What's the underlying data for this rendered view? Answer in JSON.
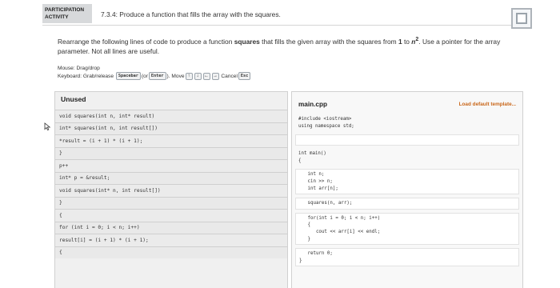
{
  "header": {
    "badge_line1": "PARTICIPATION",
    "badge_line2": "ACTIVITY",
    "title": "7.3.4: Produce a function that fills the array with the squares."
  },
  "instructions": {
    "part1": "Rearrange the following lines of code to produce a function ",
    "bold_name": "squares",
    "part2": " that fills the given array with the squares from ",
    "range_start": "1",
    "part3": " to ",
    "range_end": "n",
    "superscript": "2",
    "part4": ". Use a pointer for the array parameter. Not all lines are useful."
  },
  "controls": {
    "mouse": "Mouse: Drag/drop",
    "keyboard_prefix": "Keyboard: Grab/release",
    "spacebar_key": "Spacebar",
    "or_open": "(or",
    "enter_key": "Enter",
    "or_close": ").",
    "move_label": "Move",
    "arrow_up": "↑",
    "arrow_down": "↓",
    "arrow_left": "←",
    "arrow_right": "→",
    "cancel_label": "Cancel",
    "esc_key": "Esc"
  },
  "unused": {
    "title": "Unused",
    "lines": [
      "void squares(int n, int* result)",
      "int* squares(int n, int result[])",
      "*result = (i + 1) * (i + 1);",
      "}",
      "p++",
      "int* p = &result;",
      "void squares(int* n, int result[])",
      "}",
      "{",
      "for (int i = 0; i < n; i++)",
      "result[i] = (i + 1) * (i + 1);",
      "{"
    ]
  },
  "main": {
    "file_name": "main.cpp",
    "load_default": "Load default template...",
    "blocks": [
      {
        "slot": false,
        "code": "#include <iostream>\nusing namespace std;"
      },
      {
        "slot": true,
        "code": ""
      },
      {
        "slot": false,
        "code": "int main()\n{"
      },
      {
        "slot": false,
        "code": "   int n;\n   cin >> n;\n   int arr[n];"
      },
      {
        "slot": false,
        "code": "   squares(n, arr);"
      },
      {
        "slot": false,
        "code": "   for(int i = 0; i < n; i++)\n   {\n      cout << arr[i] << endl;\n   }"
      },
      {
        "slot": false,
        "code": "   return 0;\n}"
      }
    ]
  }
}
